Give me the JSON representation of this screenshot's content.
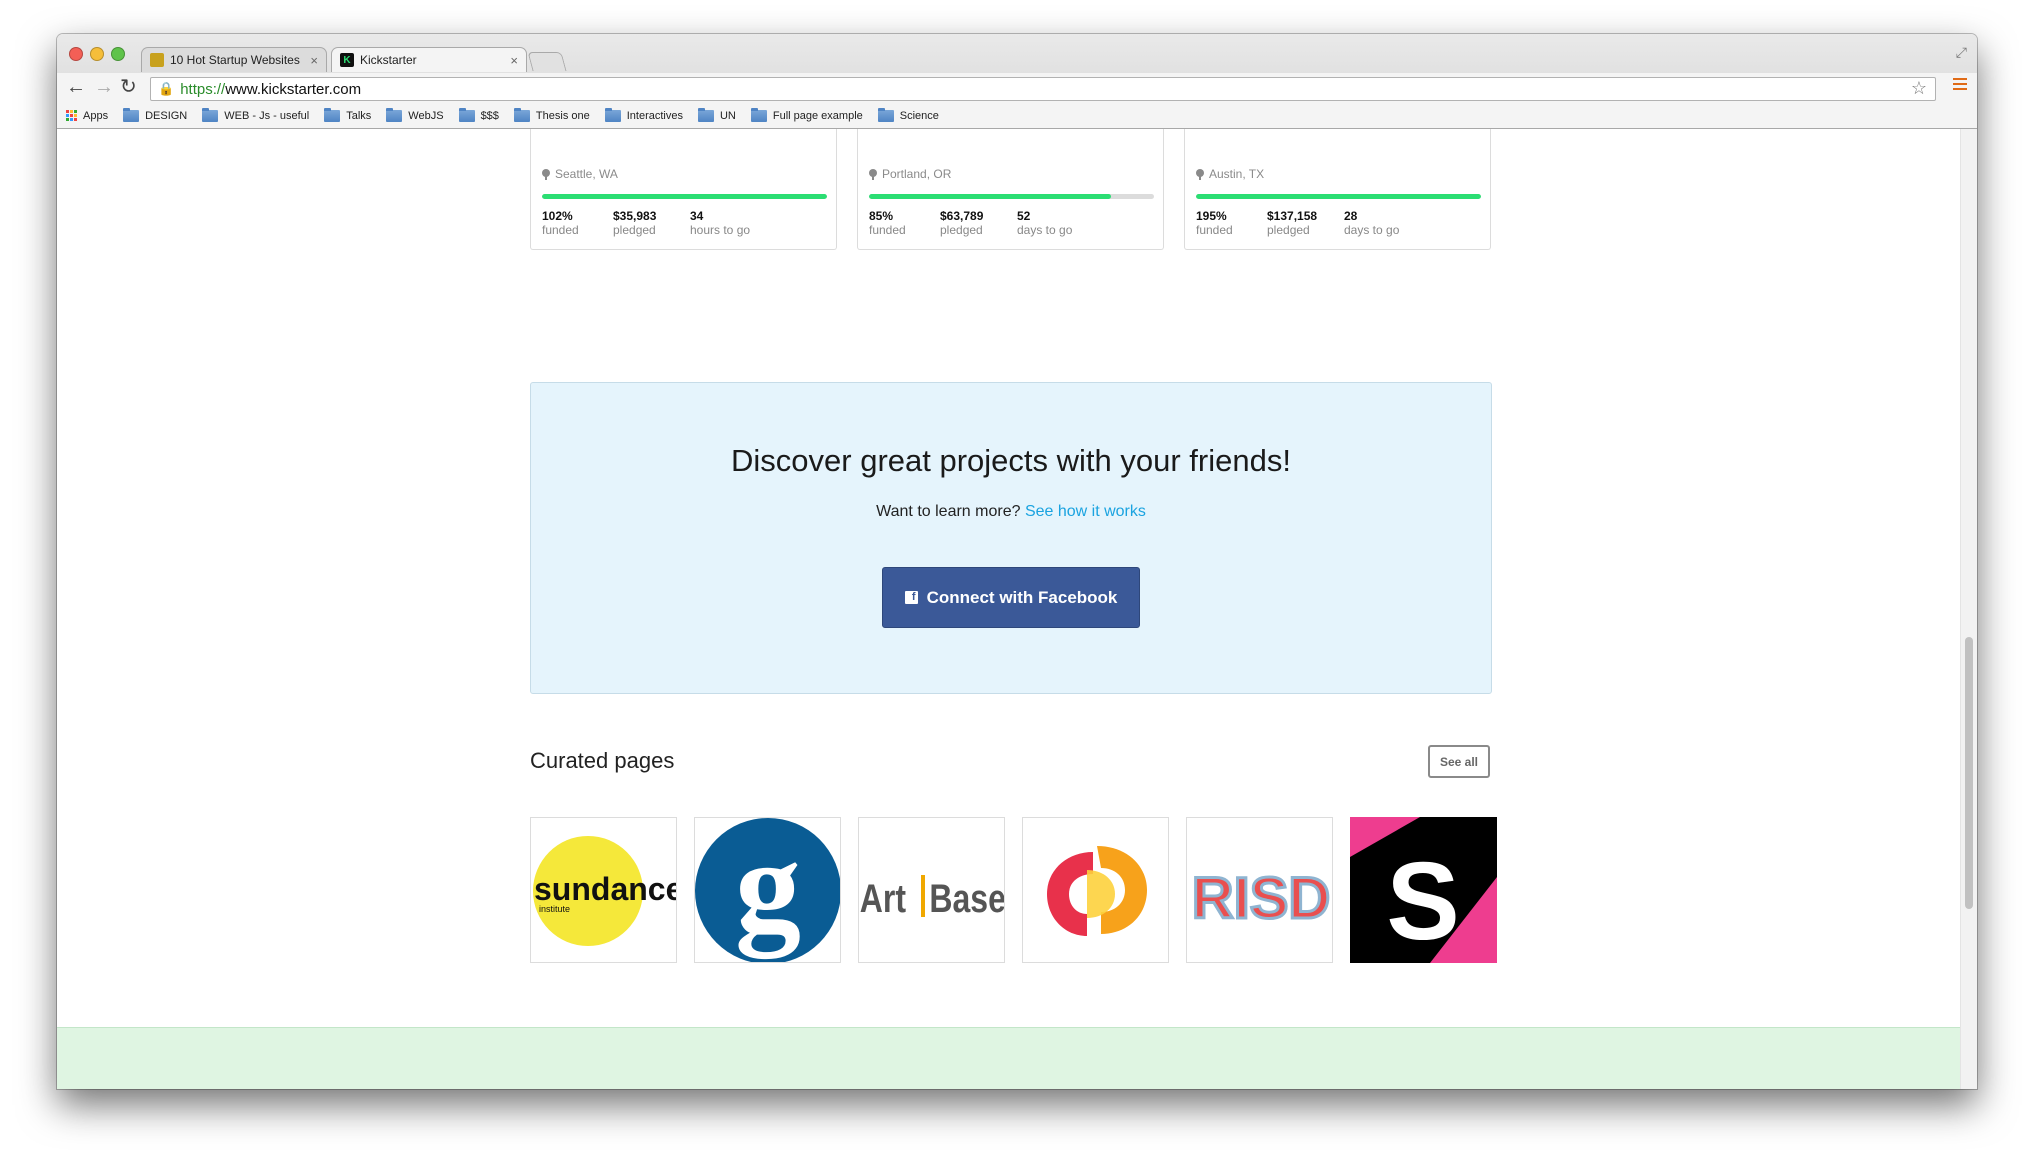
{
  "browser": {
    "tabs": [
      {
        "title": "10 Hot Startup Websites | ",
        "close": "×",
        "favicon_color": "#c8a11d"
      },
      {
        "title": "Kickstarter",
        "close": "×",
        "favicon_color": "#0f0f0f"
      }
    ],
    "url": {
      "protocol": "https://",
      "host": "www.kickstarter.com"
    },
    "bookmarks": [
      "Apps",
      "DESIGN",
      "WEB - Js - useful",
      "Talks",
      "WebJS",
      "$$$",
      "Thesis one",
      "Interactives",
      "UN",
      "Full page example",
      "Science"
    ]
  },
  "projects": [
    {
      "location": "Seattle, WA",
      "progress": 1.0,
      "funded": "102%",
      "funded_label": "funded",
      "pledged": "$35,983",
      "pledged_label": "pledged",
      "time": "34",
      "time_label": "hours to go"
    },
    {
      "location": "Portland, OR",
      "progress": 0.85,
      "funded": "85%",
      "funded_label": "funded",
      "pledged": "$63,789",
      "pledged_label": "pledged",
      "time": "52",
      "time_label": "days to go"
    },
    {
      "location": "Austin, TX",
      "progress": 1.0,
      "funded": "195%",
      "funded_label": "funded",
      "pledged": "$137,158",
      "pledged_label": "pledged",
      "time": "28",
      "time_label": "days to go"
    }
  ],
  "friends": {
    "heading": "Discover great projects with your friends!",
    "prompt": "Want to learn more?",
    "link": "See how it works",
    "button": "Connect with Facebook"
  },
  "curated": {
    "title": "Curated pages",
    "see_all": "See all",
    "logos": [
      {
        "name": "sundance",
        "text": "sundance",
        "subtext": "institute"
      },
      {
        "name": "guardian",
        "text": "g"
      },
      {
        "name": "art-basel",
        "text_left": "Art",
        "text_right": "Basel"
      },
      {
        "name": "orange-p",
        "text": ""
      },
      {
        "name": "risd",
        "text": "RISD"
      },
      {
        "name": "s",
        "text": "S"
      }
    ]
  },
  "colors": {
    "accent_green": "#2bde73",
    "facebook_blue": "#3b5998",
    "link_blue": "#1aa3e0",
    "friends_bg": "#e5f4fc",
    "footer_bg": "#dff5e2"
  }
}
